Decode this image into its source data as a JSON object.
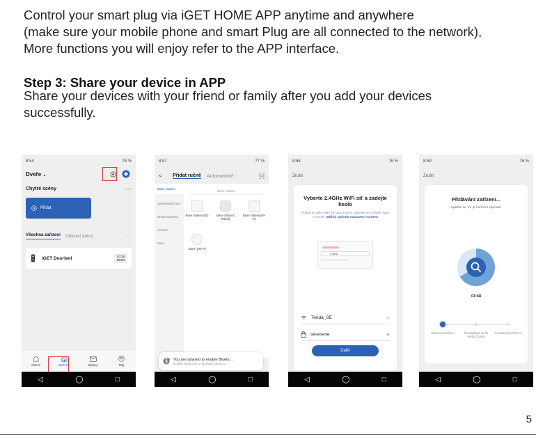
{
  "intro": {
    "line1": "Control your smart plug via iGET HOME  APP anytime and anywhere",
    "line2": "(make sure your mobile phone and smart Plug are all connected to the network),",
    "line3": "More functions you will enjoy refer to the APP interface."
  },
  "step": {
    "title": "Step 3: Share your device in APP",
    "text": "Share your devices with your friend or family after you add your devices successfully."
  },
  "page_number": "5",
  "screen1": {
    "time": "8:54",
    "battery": "78 %",
    "home_title": "Dveře",
    "scenes_label": "Chytré scény",
    "scenes_more": "více",
    "add_label": "Přidat",
    "tab_all": "Všechna zařízení",
    "tab_room": "Obývací pokoj",
    "tab_more": "···",
    "device_name": "iGET Doorbell",
    "device_time1": "10:15",
    "device_time2": "08:54",
    "nav": [
      "Aktivní",
      "Zařízení",
      "Zprávy",
      "Můj"
    ]
  },
  "screen2": {
    "time": "8:57",
    "battery": "77 %",
    "back": "<",
    "tab_manual": "Přidat ručně",
    "tab_auto": "Automatické :",
    "sidebar": [
      "Base Station",
      "Sensors&Al arm",
      "Smart Camera",
      "Access",
      "Vice..."
    ],
    "section": "Base Station",
    "devices": [
      "Base Station(4G)",
      "Base Station( Wired)",
      "Base Station(Wi-Fi)",
      "Alarm (Wi-Fi)"
    ],
    "bt_title": "You are advised to enable Blueto...",
    "bt_text": "Enable Bluetooth to facilitate addition..."
  },
  "screen3": {
    "time": "8:58",
    "battery": "76 %",
    "cancel": "Zrušit",
    "title": "Vyberte 2.4GHz WiFi síť a zadejte heslo",
    "sub": "Pokud je vaše WiFi síť typu 5 GHz, připojte se na WiFi typu 2.4 GHz.",
    "sub_link": "Běžný způsob nastavení routeru",
    "router_band": "2.4Ghz",
    "wifi_name": "Tenda_SE",
    "password": "sesesese",
    "next": "Další"
  },
  "screen4": {
    "time": "8:59",
    "battery": "76 %",
    "cancel": "Zrušit",
    "title": "Přidávání zařízení...",
    "sub": "Ujistěte se, že je zařízení zapnuté.",
    "timer": "01:58",
    "steps": [
      "Skenovat zařízení",
      "Zaregistrujte se do svého Cloudu",
      "Inicializovat zařízení"
    ]
  },
  "colors": {
    "accent": "#2b62b6",
    "highlight": "#e23b3b",
    "ring": "#6fa3d6"
  }
}
